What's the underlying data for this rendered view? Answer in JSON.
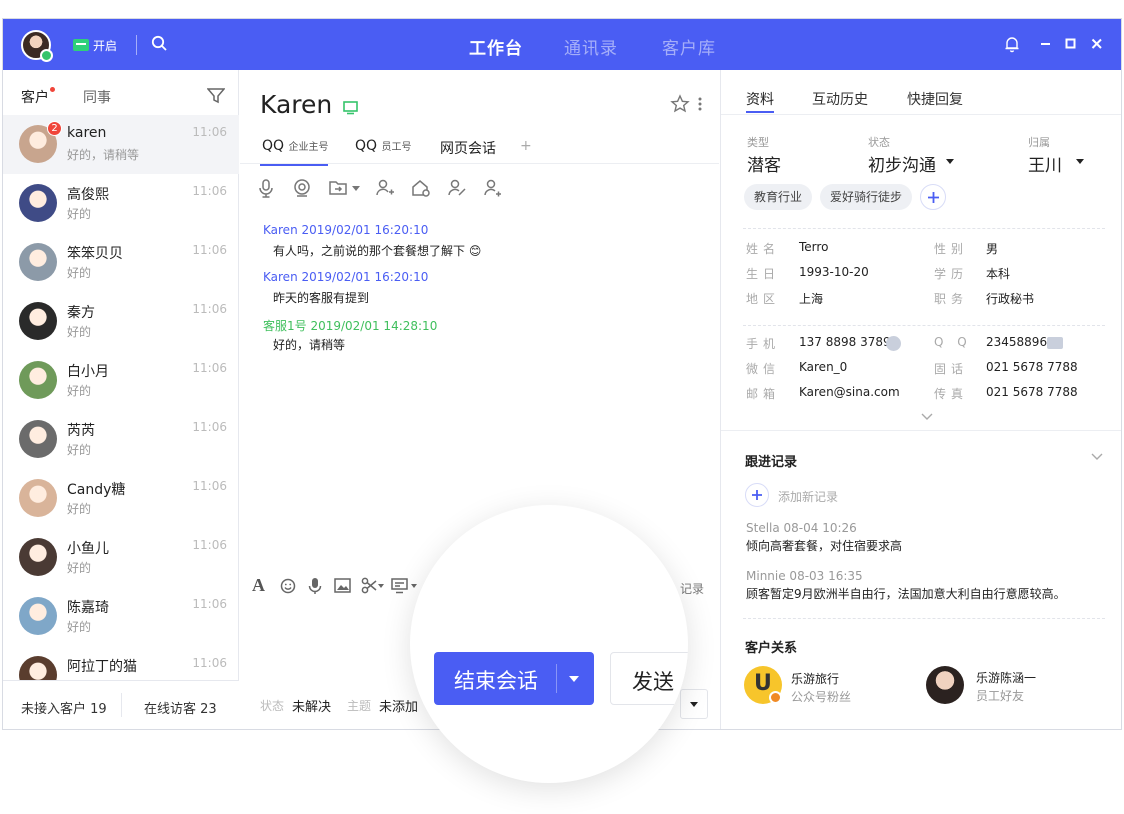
{
  "topbar": {
    "status_label": "开启",
    "nav": [
      "工作台",
      "通讯录",
      "客户库"
    ],
    "window_controls": [
      "bell-icon",
      "minimize-icon",
      "maximize-icon",
      "close-icon"
    ]
  },
  "left": {
    "tabs": [
      "客户",
      "同事"
    ],
    "conversations": [
      {
        "name": "karen",
        "preview": "好的，请稍等",
        "time": "11:06",
        "badge": "2",
        "avatar": "#c8a58e"
      },
      {
        "name": "高俊熙",
        "preview": "好的",
        "time": "11:06",
        "badge": "",
        "avatar": "#3f4b86"
      },
      {
        "name": "笨笨贝贝",
        "preview": "好的",
        "time": "11:06",
        "badge": "",
        "avatar": "#8c9aa8"
      },
      {
        "name": "秦方",
        "preview": "好的",
        "time": "11:06",
        "badge": "",
        "avatar": "#2a2a2a"
      },
      {
        "name": "白小月",
        "preview": "好的",
        "time": "11:06",
        "badge": "",
        "avatar": "#6f9a5a"
      },
      {
        "name": "芮芮",
        "preview": "好的",
        "time": "11:06",
        "badge": "",
        "avatar": "#6b6b6b"
      },
      {
        "name": "Candy糖",
        "preview": "好的",
        "time": "11:06",
        "badge": "",
        "avatar": "#d9b49a"
      },
      {
        "name": "小鱼儿",
        "preview": "好的",
        "time": "11:06",
        "badge": "",
        "avatar": "#4a3a34"
      },
      {
        "name": "陈嘉琦",
        "preview": "好的",
        "time": "11:06",
        "badge": "",
        "avatar": "#7fa7c8"
      },
      {
        "name": "阿拉丁的猫",
        "preview": "",
        "time": "11:06",
        "badge": "",
        "avatar": "#5a3d2e"
      }
    ],
    "footer": {
      "pending": "未接入客户 19",
      "online": "在线访客 23"
    }
  },
  "chat": {
    "title": "Karen",
    "tabs": [
      {
        "label": "QQ",
        "sub": "企业主号"
      },
      {
        "label": "QQ",
        "sub": "员工号"
      },
      {
        "label": "网页会话",
        "sub": ""
      },
      {
        "label": "+",
        "sub": ""
      }
    ],
    "messages": [
      {
        "header": "Karen 2019/02/01 16:20:10",
        "body": "有人吗，之前说的那个套餐想了解下 😊",
        "color": "#4a5df3"
      },
      {
        "header": "Karen 2019/02/01 16:20:10",
        "body": "昨天的客服有提到",
        "color": "#4a5df3"
      },
      {
        "header": "客服1号 2019/02/01 14:28:10",
        "body": "好的，请稍等",
        "color": "#3fbf5c"
      }
    ],
    "history_label": "记录",
    "status": {
      "label": "状态",
      "value": "未解决",
      "topic_label": "主题",
      "topic_value": "未添加"
    },
    "end_button": "结束会话",
    "send_button": "发送"
  },
  "profile": {
    "tabs": [
      "资料",
      "互动历史",
      "快捷回复"
    ],
    "type": {
      "label": "类型",
      "value": "潜客"
    },
    "status": {
      "label": "状态",
      "value": "初步沟通"
    },
    "owner": {
      "label": "归属",
      "value": "王川"
    },
    "tags": [
      "教育行业",
      "爱好骑行徒步"
    ],
    "basic": [
      {
        "label": "姓名",
        "value": "Terro"
      },
      {
        "label": "性别",
        "value": "男"
      },
      {
        "label": "生日",
        "value": "1993-10-20"
      },
      {
        "label": "学历",
        "value": "本科"
      },
      {
        "label": "地区",
        "value": "上海"
      },
      {
        "label": "职务",
        "value": "行政秘书"
      }
    ],
    "contact": [
      {
        "label": "手机",
        "value": "137 8898 3789"
      },
      {
        "label": "Q Q",
        "value": "23458896"
      },
      {
        "label": "微信",
        "value": "Karen_0"
      },
      {
        "label": "固话",
        "value": "021 5678 7788"
      },
      {
        "label": "邮箱",
        "value": "Karen@sina.com"
      },
      {
        "label": "传真",
        "value": "021 5678 7788"
      }
    ],
    "followup": {
      "title": "跟进记录",
      "add_label": "添加新记录",
      "records": [
        {
          "meta": "Stella  08-04  10:26",
          "text": "倾向高奢套餐，对住宿要求高"
        },
        {
          "meta": "Minnie  08-03  16:35",
          "text": "顾客暂定9月欧洲半自由行，法国加意大利自由行意愿较高。"
        }
      ]
    },
    "relations": {
      "title": "客户关系",
      "items": [
        {
          "name": "乐游旅行",
          "role": "公众号粉丝"
        },
        {
          "name": "乐游陈涵一",
          "role": "员工好友"
        }
      ]
    }
  }
}
